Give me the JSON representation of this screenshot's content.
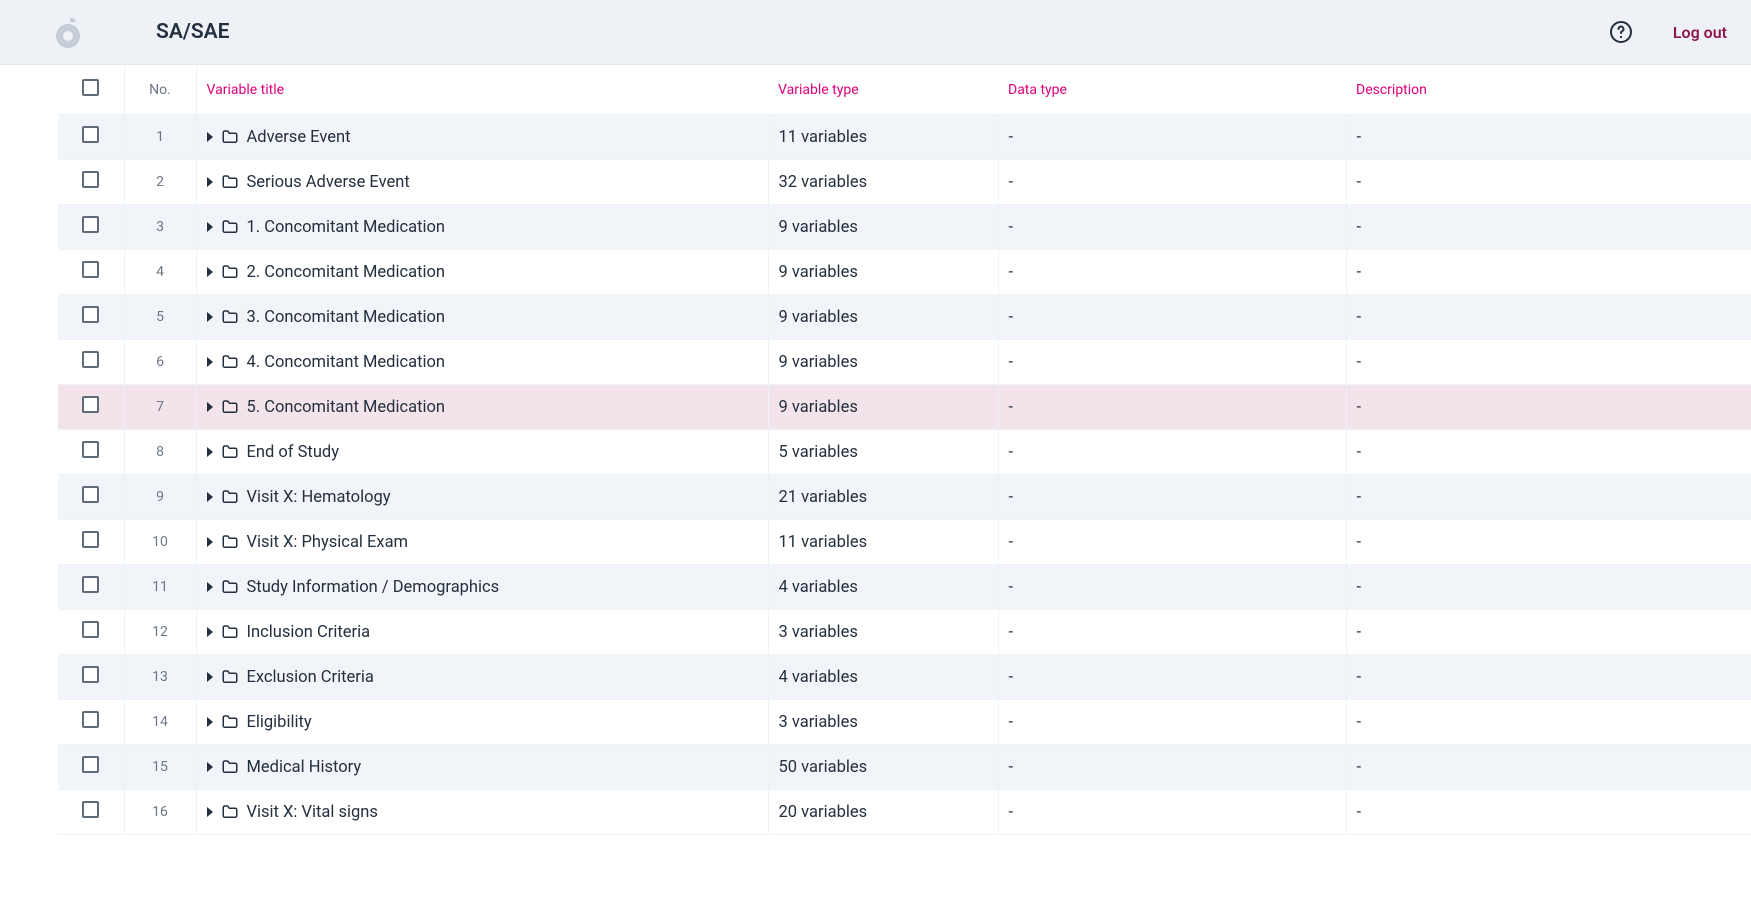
{
  "header": {
    "title": "SA/SAE",
    "logout": "Log out"
  },
  "columns": {
    "no": "No.",
    "title": "Variable title",
    "type": "Variable type",
    "dtype": "Data type",
    "desc": "Description"
  },
  "highlighted_index": 6,
  "rows": [
    {
      "no": "1",
      "title": "Adverse Event",
      "type": "11 variables",
      "dtype": "-",
      "desc": "-"
    },
    {
      "no": "2",
      "title": "Serious Adverse Event",
      "type": "32 variables",
      "dtype": "-",
      "desc": "-"
    },
    {
      "no": "3",
      "title": "1. Concomitant Medication",
      "type": "9 variables",
      "dtype": "-",
      "desc": "-"
    },
    {
      "no": "4",
      "title": "2. Concomitant Medication",
      "type": "9 variables",
      "dtype": "-",
      "desc": "-"
    },
    {
      "no": "5",
      "title": "3. Concomitant Medication",
      "type": "9 variables",
      "dtype": "-",
      "desc": "-"
    },
    {
      "no": "6",
      "title": "4. Concomitant Medication",
      "type": "9 variables",
      "dtype": "-",
      "desc": "-"
    },
    {
      "no": "7",
      "title": "5. Concomitant Medication",
      "type": "9 variables",
      "dtype": "-",
      "desc": "-"
    },
    {
      "no": "8",
      "title": "End of Study",
      "type": "5 variables",
      "dtype": "-",
      "desc": "-"
    },
    {
      "no": "9",
      "title": "Visit X: Hematology",
      "type": "21 variables",
      "dtype": "-",
      "desc": "-"
    },
    {
      "no": "10",
      "title": "Visit X: Physical Exam",
      "type": "11 variables",
      "dtype": "-",
      "desc": "-"
    },
    {
      "no": "11",
      "title": "Study Information / Demographics",
      "type": "4 variables",
      "dtype": "-",
      "desc": "-"
    },
    {
      "no": "12",
      "title": "Inclusion Criteria",
      "type": "3 variables",
      "dtype": "-",
      "desc": "-"
    },
    {
      "no": "13",
      "title": "Exclusion Criteria",
      "type": "4 variables",
      "dtype": "-",
      "desc": "-"
    },
    {
      "no": "14",
      "title": "Eligibility",
      "type": "3 variables",
      "dtype": "-",
      "desc": "-"
    },
    {
      "no": "15",
      "title": "Medical History",
      "type": "50 variables",
      "dtype": "-",
      "desc": "-"
    },
    {
      "no": "16",
      "title": "Visit X: Vital signs",
      "type": "20 variables",
      "dtype": "-",
      "desc": "-"
    }
  ]
}
